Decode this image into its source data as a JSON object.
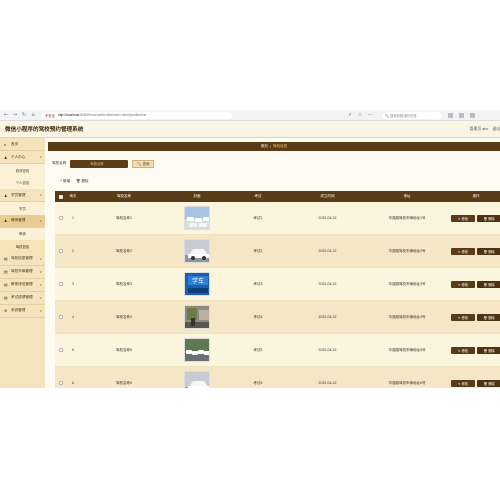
{
  "browser": {
    "back": "←",
    "forward": "→",
    "refresh": "↻",
    "home": "⌂",
    "insecure_label": "不安全",
    "url_host": "http://localhost:",
    "url_path": "8080/lenss/admin/dist/index.html#/jiaolianshe",
    "controls": [
      "⚡",
      "☆",
      "⋯"
    ],
    "search_placeholder": "🔍 搜索你想找的东西"
  },
  "header": {
    "title": "微信小程序的驾校预约管理系统",
    "user_role": "管理员 abo",
    "logout": "退出"
  },
  "sidebar": {
    "items": [
      {
        "icon": "⌂",
        "label": "首页",
        "chevron": ""
      },
      {
        "icon": "♟",
        "label": "个人中心",
        "chevron": "∨"
      },
      {
        "sub": "修改密码"
      },
      {
        "sub": "个人信息"
      },
      {
        "icon": "♟",
        "label": "学员管理",
        "chevron": "∨"
      },
      {
        "sub": "学员"
      },
      {
        "icon": "♟",
        "label": "教练管理",
        "chevron": "∨",
        "active": true
      },
      {
        "sub": "教练"
      },
      {
        "sub": "驾校信息",
        "active": true
      },
      {
        "icon": "▤",
        "label": "驾校信息管理",
        "chevron": "∨"
      },
      {
        "icon": "▤",
        "label": "驾校车辆管理",
        "chevron": "∨"
      },
      {
        "icon": "▤",
        "label": "教练排班管理",
        "chevron": "∨"
      },
      {
        "icon": "▤",
        "label": "考试成绩管理",
        "chevron": "∨"
      },
      {
        "icon": "⚙",
        "label": "系统管理",
        "chevron": "∨"
      }
    ]
  },
  "breadcrumb": {
    "home": "首页",
    "sep": "/",
    "current": "驾校信息"
  },
  "search": {
    "label": "驾校名称",
    "placeholder": "驾校名称",
    "button": "查询",
    "button_icon": "🔍"
  },
  "actions": {
    "add": "+ 新增",
    "delete": "🗑 删除"
  },
  "table": {
    "headers": [
      "",
      "索引",
      "驾校名称",
      "封面",
      "考试",
      "成立时间",
      "地址",
      "操作"
    ],
    "edit_label": "✎ 修改",
    "del_label": "🗑 删除",
    "rows": [
      {
        "index": "1",
        "name": "驾校名称1",
        "coach": "考试1",
        "date": "2022-04-22",
        "address": "华强路驾校车辆地址1号",
        "thumb": "cars-lot"
      },
      {
        "index": "2",
        "name": "驾校名称2",
        "coach": "考试2",
        "date": "2022-04-22",
        "address": "华强路驾校车辆地址2号",
        "thumb": "white-car"
      },
      {
        "index": "3",
        "name": "驾校名称3",
        "coach": "考试3",
        "date": "2022-04-22",
        "address": "华强路驾校车辆地址3号",
        "thumb": "student-sign"
      },
      {
        "index": "4",
        "name": "驾校名称4",
        "coach": "考试4",
        "date": "2022-04-22",
        "address": "华强路驾校车辆地址4号",
        "thumb": "indoor"
      },
      {
        "index": "5",
        "name": "驾校名称5",
        "coach": "考试5",
        "date": "2022-04-22",
        "address": "华强路驾校车辆地址5号",
        "thumb": "cars-row"
      },
      {
        "index": "6",
        "name": "驾校名称6",
        "coach": "考试6",
        "date": "2022-04-22",
        "address": "华强路驾校车辆地址6号",
        "thumb": "white-car"
      }
    ]
  },
  "colors": {
    "brown": "#5a3b17",
    "sidebar": "#f4e3bd",
    "row_alt": "#f5e7c5"
  }
}
